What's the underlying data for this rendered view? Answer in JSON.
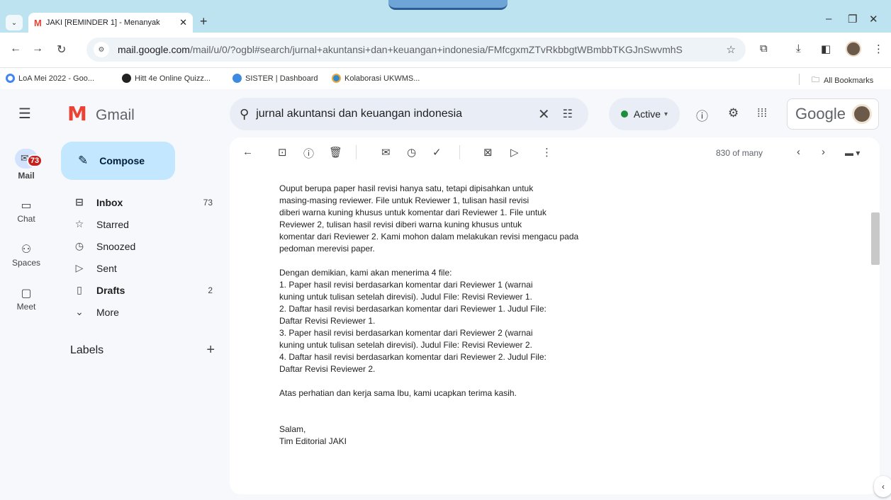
{
  "browser": {
    "tab_title": "JAKI [REMINDER 1] - Menanyak",
    "url_host": "mail.google.com",
    "url_path": "/mail/u/0/?ogbl#search/jurnal+akuntansi+dan+keuangan+indonesia/FMfcgxmZTvRkbbgtWBmbbTKGJnSwvmhS",
    "bookmarks": [
      "LoA Mei 2022 - Goo...",
      "Hitt 4e Online Quizz...",
      "SISTER | Dashboard",
      "Kolaborasi UKWMS..."
    ],
    "all_bookmarks": "All Bookmarks",
    "colors": {
      "tabstrip": "#bde3f0"
    }
  },
  "gmail": {
    "logo_text": "Gmail",
    "search_value": "jurnal akuntansi dan keuangan indonesia",
    "status": "Active",
    "google_label": "Google",
    "rail": {
      "mail": "Mail",
      "mail_badge": "73",
      "chat": "Chat",
      "spaces": "Spaces",
      "meet": "Meet"
    },
    "compose_label": "Compose",
    "nav": {
      "inbox": "Inbox",
      "inbox_count": "73",
      "starred": "Starred",
      "snoozed": "Snoozed",
      "sent": "Sent",
      "drafts": "Drafts",
      "drafts_count": "2",
      "more": "More"
    },
    "labels_heading": "Labels",
    "pager": "830 of many",
    "message_lines": [
      "Ouput berupa paper hasil revisi hanya satu, tetapi dipisahkan untuk",
      "masing-masing reviewer. File untuk Reviewer 1, tulisan hasil revisi",
      "diberi warna kuning khusus untuk komentar dari Reviewer 1. File untuk",
      "Reviewer 2, tulisan hasil revisi diberi warna kuning khusus untuk",
      "komentar dari Reviewer 2. Kami mohon dalam melakukan revisi mengacu pada",
      "pedoman merevisi paper.",
      "",
      "Dengan demikian, kami akan menerima 4 file:",
      "1. Paper hasil revisi berdasarkan komentar dari Reviewer 1 (warnai",
      "kuning untuk tulisan setelah direvisi). Judul File: Revisi Reviewer 1.",
      "2. Daftar hasil revisi berdasarkan komentar dari Reviewer 1. Judul File:",
      "Daftar Revisi Reviewer 1.",
      "3. Paper hasil revisi berdasarkan komentar dari Reviewer 2 (warnai",
      "kuning untuk tulisan setelah direvisi). Judul File: Revisi Reviewer 2.",
      "4. Daftar hasil revisi berdasarkan komentar dari Reviewer 2. Judul File:",
      "Daftar Revisi Reviewer 2.",
      "",
      "Atas perhatian dan kerja sama Ibu, kami ucapkan terima kasih.",
      "",
      "",
      "Salam,",
      "Tim Editorial JAKI"
    ],
    "colors": {
      "accent": "#c2e7ff",
      "badge": "#c5221f",
      "active": "#1e8e3e"
    }
  }
}
